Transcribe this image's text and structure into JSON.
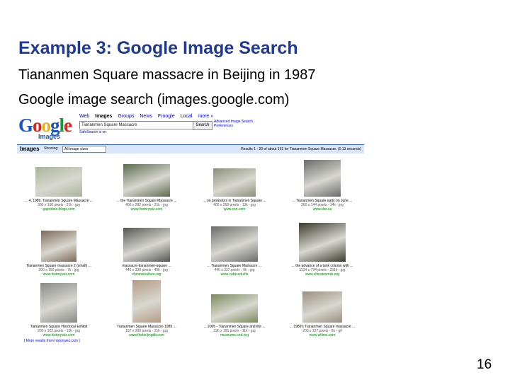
{
  "slide": {
    "title": "Example 3: Google Image Search",
    "line1": "Tiananmen Square massacre in Beijing in 1987",
    "line2": "Google image search (images.google.com)",
    "page_number": "16"
  },
  "google": {
    "logo_letters": [
      "G",
      "o",
      "o",
      "g",
      "l",
      "e"
    ],
    "logo_sub": "Images",
    "tabs": [
      "Web",
      "Images",
      "Groups",
      "News",
      "Froogle",
      "Local",
      "more »"
    ],
    "active_tab": "Images",
    "query": "Tiananmen Square Massacre",
    "search_button": "Search",
    "advanced_links": [
      "Advanced Image Search",
      "Preferences"
    ],
    "safe_search": "SafeSearch is on",
    "bar_label": "Images",
    "showing_label": "Showing:",
    "size_select": "All image sizes",
    "results_text": "Results 1 - 20 of about 161 for Tiananmen Square Massacre. (0.13 seconds)",
    "more_link": "[ More results from historywiz.com ]",
    "results": [
      {
        "caption": "... 4, 1989, Tiananmen Square Massacre ...",
        "meta": "300 x 156 pixels - 21k - jpg",
        "domain": "gaprobee.blogs.com"
      },
      {
        "caption": "... the Tiananmen Square Massacre ...",
        "meta": "400 x 282 pixels - 21k - jpg",
        "domain": "www.historywiz.com"
      },
      {
        "caption": "... on protestors in Tiananmen Square ...",
        "meta": "400 x 258 pixels - 13k - jpg",
        "domain": "www.cnn.com"
      },
      {
        "caption": "... Tiananmen Square early on June ...",
        "meta": "200 x 144 pixels - 14k - jpg",
        "domain": "www.cbs.ca"
      },
      {
        "caption": "Tiananmen Square massacre 2 (small) ...",
        "meta": "200 x 150 pixels - 7k - jpg",
        "domain": "www.historywiz.com"
      },
      {
        "caption": "massacre-tiananmen-square ...",
        "meta": "440 x 330 pixels - 40k - jpg",
        "domain": "chineseculture.org"
      },
      {
        "caption": "... Tiananmen Square Massacre ...",
        "meta": "440 x 337 pixels - 9k - jpg",
        "domain": "www.cuhk.edu.hk"
      },
      {
        "caption": "... the advance of a tank column with ...",
        "meta": "1124 x 794 pixels - 231k - jpg",
        "domain": "www.chinatownsk.org"
      },
      {
        "caption": "Tiananmen Square Historical Exhibit",
        "meta": "200 x 322 pixels - 12k - jpg",
        "domain": "www.historywiz.com"
      },
      {
        "caption": "Tiananmen Square Massacre 1989 ...",
        "meta": "197 x 300 pixels - 21k - jpg",
        "domain": "www.thebeijingdb.com"
      },
      {
        "caption": "... 2005 - Tiananmen Square and the ...",
        "meta": "336 x 195 pixels - 11k - jpg",
        "domain": "museums.cnd.org"
      },
      {
        "caption": "... 1989's Tiananmen Square massacre ...",
        "meta": "200 x 127 pixels - 6k - gif",
        "domain": "www.wtlims.com"
      }
    ]
  },
  "colors": {
    "title": "#1f3a93",
    "link": "#0000cc",
    "bar": "#dbe6fb",
    "domain": "#008000"
  }
}
